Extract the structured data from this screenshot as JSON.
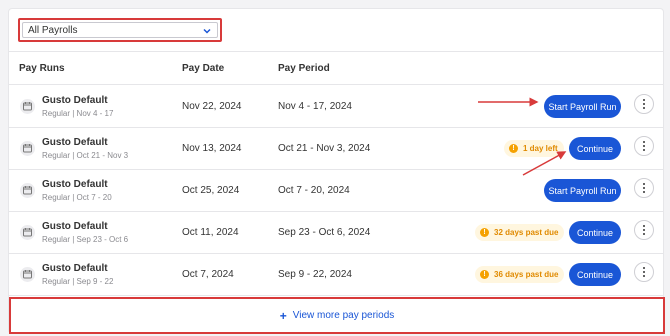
{
  "filter": {
    "value": "All Payrolls"
  },
  "table": {
    "headers": {
      "pay_runs": "Pay Runs",
      "pay_date": "Pay Date",
      "pay_period": "Pay Period"
    },
    "rows": [
      {
        "name": "Gusto Default",
        "sub": "Regular | Nov 4 - 17",
        "pay_date": "Nov 22, 2024",
        "period": "Nov 4 - 17, 2024",
        "status": "",
        "action": "Start Payroll Run"
      },
      {
        "name": "Gusto Default",
        "sub": "Regular | Oct 21 - Nov 3",
        "pay_date": "Nov 13, 2024",
        "period": "Oct 21 - Nov 3, 2024",
        "status": "1 day left",
        "action": "Continue"
      },
      {
        "name": "Gusto Default",
        "sub": "Regular | Oct 7 - 20",
        "pay_date": "Oct 25, 2024",
        "period": "Oct 7 - 20, 2024",
        "status": "",
        "action": "Start Payroll Run"
      },
      {
        "name": "Gusto Default",
        "sub": "Regular | Sep 23 - Oct 6",
        "pay_date": "Oct 11, 2024",
        "period": "Sep 23 - Oct 6, 2024",
        "status": "32 days past due",
        "action": "Continue"
      },
      {
        "name": "Gusto Default",
        "sub": "Regular | Sep 9 - 22",
        "pay_date": "Oct 7, 2024",
        "period": "Sep 9 - 22, 2024",
        "status": "36 days past due",
        "action": "Continue"
      }
    ]
  },
  "more": {
    "label": "View more pay periods"
  },
  "status_icon_glyph": "!",
  "colors": {
    "accent": "#1a56d6",
    "highlight": "#d83a3a",
    "warning": "#f5a100",
    "warning_bg": "#fff6df"
  }
}
